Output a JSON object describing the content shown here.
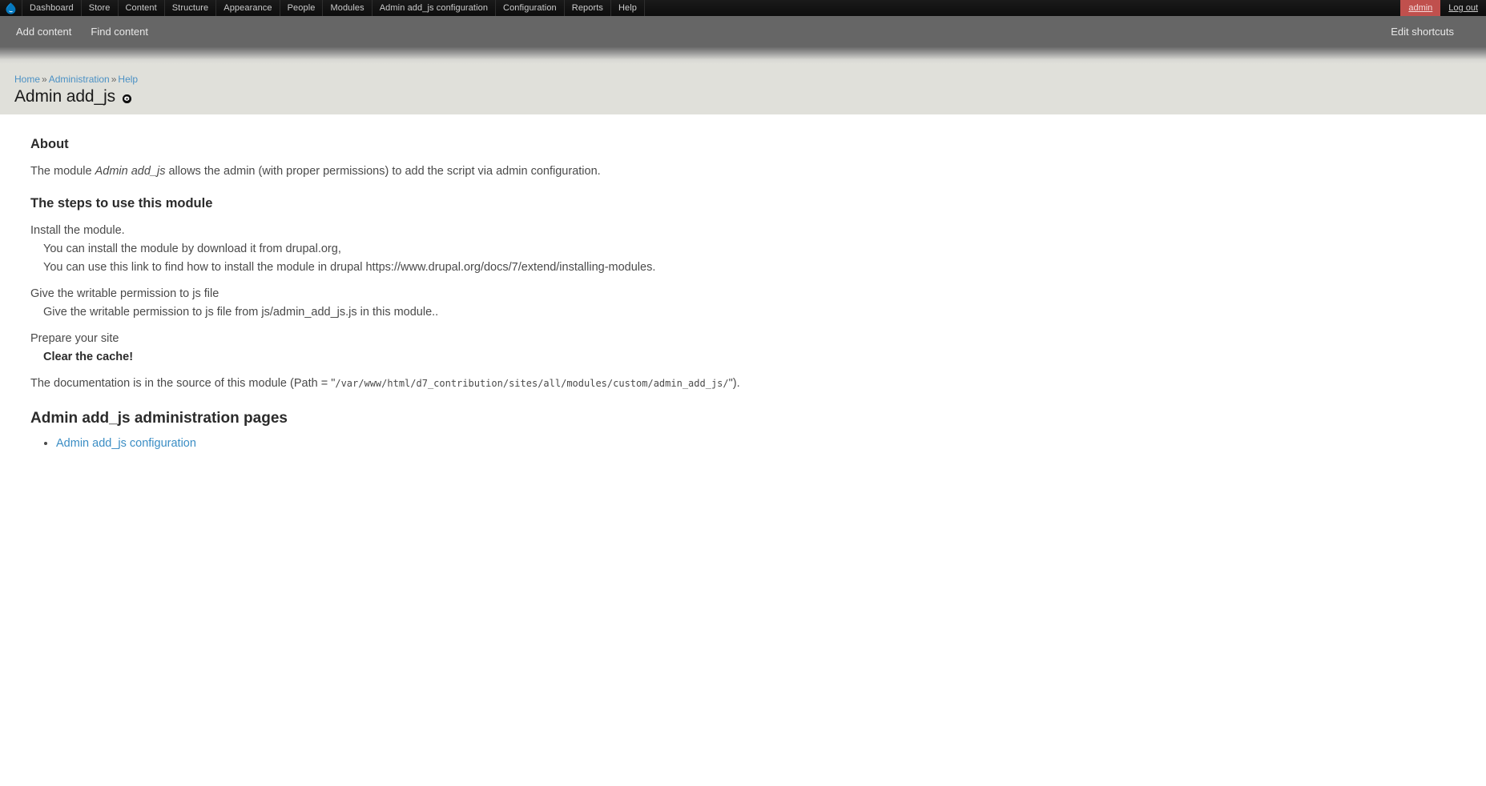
{
  "toolbar": {
    "logo_icon": "drupal-droplet-icon",
    "menu": [
      {
        "label": "Dashboard"
      },
      {
        "label": "Store"
      },
      {
        "label": "Content"
      },
      {
        "label": "Structure"
      },
      {
        "label": "Appearance"
      },
      {
        "label": "People"
      },
      {
        "label": "Modules"
      },
      {
        "label": "Admin add_js configuration"
      },
      {
        "label": "Configuration"
      },
      {
        "label": "Reports"
      },
      {
        "label": "Help"
      }
    ],
    "user_label": "admin",
    "logout_label": "Log out",
    "user_badge_color": "#c0504d"
  },
  "shortcuts": {
    "items": [
      {
        "label": "Add content"
      },
      {
        "label": "Find content"
      }
    ],
    "edit_label": "Edit shortcuts",
    "bar_color": "#666666"
  },
  "breadcrumb": {
    "items": [
      {
        "label": "Home"
      },
      {
        "label": "Administration"
      },
      {
        "label": "Help"
      }
    ],
    "separator": "»",
    "link_color": "#4a90c4"
  },
  "page": {
    "title": "Admin add_js",
    "title_icon": "gear-circle-icon",
    "header_background": "#e0e0da"
  },
  "main": {
    "about": {
      "heading": "About",
      "text_before": "The module ",
      "emphasis": "Admin add_js",
      "text_after": " allows the admin (with proper permissions) to add the script via admin configuration."
    },
    "steps": {
      "heading": "The steps to use this module",
      "items": [
        {
          "title": "Install the module.",
          "subs": [
            "You can install the module by download it from drupal.org,",
            "You can use this link to find how to install the module in drupal https://www.drupal.org/docs/7/extend/installing-modules."
          ]
        },
        {
          "title": "Give the writable permission to js file",
          "subs": [
            "Give the writable permission to js file from js/admin_add_js.js in this module.."
          ]
        },
        {
          "title": "Prepare your site",
          "subs_bold": [
            "Clear the cache!"
          ]
        }
      ]
    },
    "documentation": {
      "prefix": "The documentation is in the source of this module (Path = \"",
      "path": "/var/www/html/d7_contribution/sites/all/modules/custom/admin_add_js/",
      "suffix": "\")."
    },
    "admin_pages": {
      "heading": "Admin add_js administration pages",
      "links": [
        {
          "label": "Admin add_js configuration"
        }
      ]
    }
  }
}
